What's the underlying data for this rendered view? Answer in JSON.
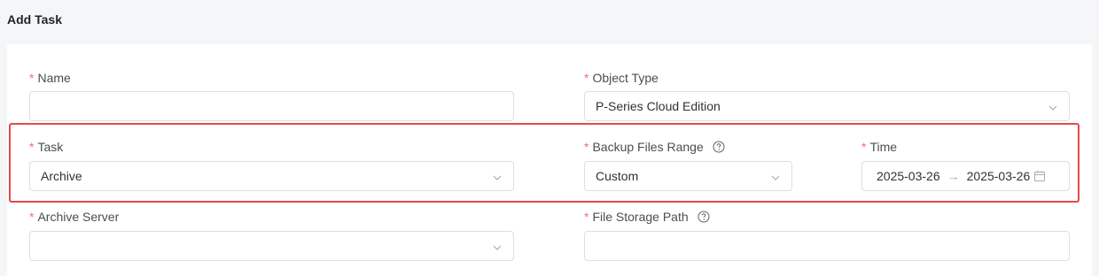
{
  "page": {
    "title": "Add Task"
  },
  "form": {
    "name": {
      "label": "Name",
      "required": "*",
      "value": ""
    },
    "object_type": {
      "label": "Object Type",
      "required": "*",
      "value": "P-Series Cloud Edition"
    },
    "task": {
      "label": "Task",
      "required": "*",
      "value": "Archive"
    },
    "backup_files_range": {
      "label": "Backup Files Range",
      "required": "*",
      "value": "Custom",
      "help_icon": "question-circle-icon"
    },
    "time": {
      "label": "Time",
      "required": "*",
      "start": "2025-03-26",
      "separator": "→",
      "end": "2025-03-26",
      "icon": "calendar-icon"
    },
    "archive_server": {
      "label": "Archive Server",
      "required": "*",
      "value": ""
    },
    "file_storage_path": {
      "label": "File Storage Path",
      "required": "*",
      "value": "",
      "help_icon": "question-circle-icon"
    }
  },
  "colors": {
    "required": "#f56c6c",
    "highlight": "#e5484d",
    "border": "#dcdfe6",
    "background": "#f5f6f8"
  }
}
